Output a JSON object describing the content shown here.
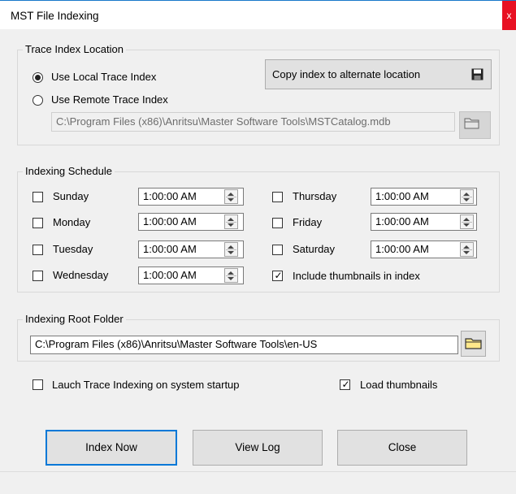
{
  "window": {
    "title": "MST File Indexing",
    "close_label": "x"
  },
  "trace_index_location": {
    "legend": "Trace Index Location",
    "local_label": "Use Local Trace Index",
    "local_selected": true,
    "remote_label": "Use Remote Trace Index",
    "remote_selected": false,
    "copy_button_label": "Copy index to alternate location",
    "remote_path": "C:\\Program Files (x86)\\Anritsu\\Master Software Tools\\MSTCatalog.mdb"
  },
  "indexing_schedule": {
    "legend": "Indexing Schedule",
    "days": [
      {
        "label": "Sunday",
        "time": "1:00:00 AM",
        "checked": false
      },
      {
        "label": "Monday",
        "time": "1:00:00 AM",
        "checked": false
      },
      {
        "label": "Tuesday",
        "time": "1:00:00 AM",
        "checked": false
      },
      {
        "label": "Wednesday",
        "time": "1:00:00 AM",
        "checked": false
      },
      {
        "label": "Thursday",
        "time": "1:00:00 AM",
        "checked": false
      },
      {
        "label": "Friday",
        "time": "1:00:00 AM",
        "checked": false
      },
      {
        "label": "Saturday",
        "time": "1:00:00 AM",
        "checked": false
      }
    ],
    "include_thumbnails_label": "Include thumbnails in index",
    "include_thumbnails_checked": true
  },
  "indexing_root": {
    "legend": "Indexing Root Folder",
    "path": "C:\\Program Files (x86)\\Anritsu\\Master Software Tools\\en-US"
  },
  "options": {
    "launch_on_startup_label": "Lauch Trace Indexing on system startup",
    "launch_on_startup_checked": false,
    "load_thumbnails_label": "Load thumbnails",
    "load_thumbnails_checked": true
  },
  "buttons": {
    "index_now": "Index Now",
    "view_log": "View Log",
    "close": "Close"
  },
  "icons": {
    "save": "floppy-disk-icon",
    "folder": "folder-icon"
  },
  "colors": {
    "title_accent": "#1979ca",
    "default_button_border": "#0078d7",
    "close_red": "#e81123",
    "folder_yellow": "#ffe88a"
  }
}
